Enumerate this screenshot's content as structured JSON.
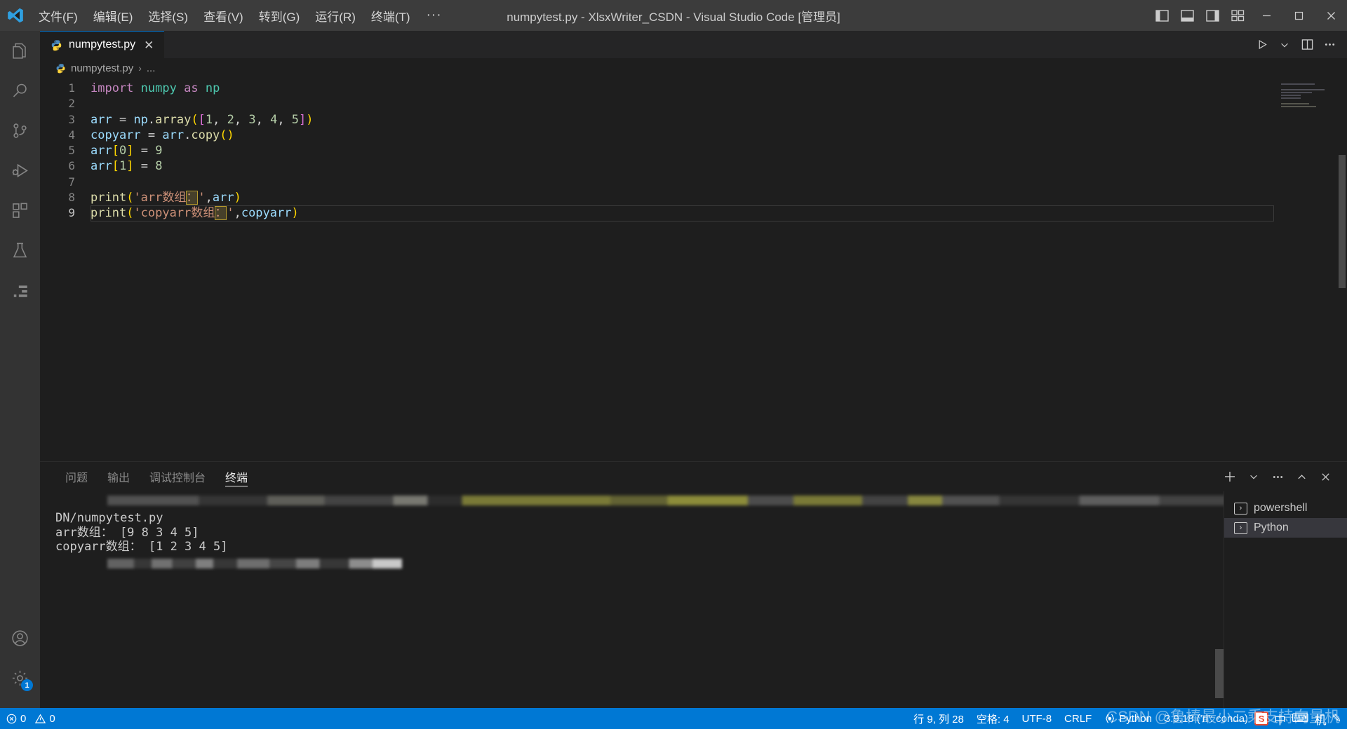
{
  "window": {
    "title": "numpytest.py - XlsxWriter_CSDN - Visual Studio Code [管理员]",
    "minimize_label": "─",
    "maximize_label": "☐",
    "close_label": "✕"
  },
  "menubar": {
    "items": [
      {
        "label": "文件(F)",
        "name": "menu-file"
      },
      {
        "label": "编辑(E)",
        "name": "menu-edit"
      },
      {
        "label": "选择(S)",
        "name": "menu-selection"
      },
      {
        "label": "查看(V)",
        "name": "menu-view"
      },
      {
        "label": "转到(G)",
        "name": "menu-go"
      },
      {
        "label": "运行(R)",
        "name": "menu-run"
      },
      {
        "label": "终端(T)",
        "name": "menu-terminal"
      }
    ],
    "overflow": "···"
  },
  "activitybar": {
    "items": [
      {
        "icon": "files-explorer-icon",
        "title": "资源管理器"
      },
      {
        "icon": "search-icon",
        "title": "搜索"
      },
      {
        "icon": "source-control-icon",
        "title": "源代码管理"
      },
      {
        "icon": "run-and-debug-icon",
        "title": "运行和调试"
      },
      {
        "icon": "extensions-icon",
        "title": "扩展"
      },
      {
        "icon": "testing-beaker-icon",
        "title": "测试"
      },
      {
        "icon": "remote-explorer-icon",
        "title": "远程资源管理器"
      }
    ],
    "bottom": [
      {
        "icon": "accounts-icon",
        "title": "帐户"
      },
      {
        "icon": "settings-gear-icon",
        "title": "管理",
        "badge": "1"
      }
    ]
  },
  "editor": {
    "tab": {
      "label": "numpytest.py",
      "icon": "python-file-icon",
      "close": "✕"
    },
    "actions": [
      {
        "icon": "run-play-icon",
        "name": "run-python-file-button"
      },
      {
        "icon": "chevron-down-icon",
        "name": "run-options-dropdown"
      },
      {
        "icon": "split-editor-icon",
        "name": "split-editor-button"
      },
      {
        "icon": "more-actions-icon",
        "name": "editor-more-actions-button"
      }
    ],
    "breadcrumb": {
      "file": "numpytest.py",
      "separator": "›",
      "trailing": "..."
    },
    "lines": [
      {
        "n": "1",
        "tokens": [
          {
            "t": "import",
            "c": "kw"
          },
          {
            "t": " ",
            "c": "op"
          },
          {
            "t": "numpy",
            "c": "mod"
          },
          {
            "t": " ",
            "c": "op"
          },
          {
            "t": "as",
            "c": "kw"
          },
          {
            "t": " ",
            "c": "op"
          },
          {
            "t": "np",
            "c": "mod"
          }
        ]
      },
      {
        "n": "2",
        "tokens": []
      },
      {
        "n": "3",
        "tokens": [
          {
            "t": "arr",
            "c": "var"
          },
          {
            "t": " = ",
            "c": "op"
          },
          {
            "t": "np",
            "c": "var"
          },
          {
            "t": ".",
            "c": "op"
          },
          {
            "t": "array",
            "c": "fn"
          },
          {
            "t": "(",
            "c": "pn1"
          },
          {
            "t": "[",
            "c": "pn2"
          },
          {
            "t": "1",
            "c": "num"
          },
          {
            "t": ", ",
            "c": "op"
          },
          {
            "t": "2",
            "c": "num"
          },
          {
            "t": ", ",
            "c": "op"
          },
          {
            "t": "3",
            "c": "num"
          },
          {
            "t": ", ",
            "c": "op"
          },
          {
            "t": "4",
            "c": "num"
          },
          {
            "t": ", ",
            "c": "op"
          },
          {
            "t": "5",
            "c": "num"
          },
          {
            "t": "]",
            "c": "pn2"
          },
          {
            "t": ")",
            "c": "pn1"
          }
        ]
      },
      {
        "n": "4",
        "tokens": [
          {
            "t": "copyarr",
            "c": "var"
          },
          {
            "t": " = ",
            "c": "op"
          },
          {
            "t": "arr",
            "c": "var"
          },
          {
            "t": ".",
            "c": "op"
          },
          {
            "t": "copy",
            "c": "fn"
          },
          {
            "t": "()",
            "c": "pn1"
          }
        ]
      },
      {
        "n": "5",
        "tokens": [
          {
            "t": "arr",
            "c": "var"
          },
          {
            "t": "[",
            "c": "pn1"
          },
          {
            "t": "0",
            "c": "num"
          },
          {
            "t": "]",
            "c": "pn1"
          },
          {
            "t": " = ",
            "c": "op"
          },
          {
            "t": "9",
            "c": "num"
          }
        ]
      },
      {
        "n": "6",
        "tokens": [
          {
            "t": "arr",
            "c": "var"
          },
          {
            "t": "[",
            "c": "pn1"
          },
          {
            "t": "1",
            "c": "num"
          },
          {
            "t": "]",
            "c": "pn1"
          },
          {
            "t": " = ",
            "c": "op"
          },
          {
            "t": "8",
            "c": "num"
          }
        ]
      },
      {
        "n": "7",
        "tokens": []
      },
      {
        "n": "8",
        "tokens": [
          {
            "t": "print",
            "c": "fn"
          },
          {
            "t": "(",
            "c": "pn1"
          },
          {
            "t": "'arr数组",
            "c": "str"
          },
          {
            "t": "：",
            "c": "str hl-box"
          },
          {
            "t": "'",
            "c": "str"
          },
          {
            "t": ",",
            "c": "op"
          },
          {
            "t": "arr",
            "c": "var"
          },
          {
            "t": ")",
            "c": "pn1"
          }
        ]
      },
      {
        "n": "9",
        "current": true,
        "tokens": [
          {
            "t": "print",
            "c": "fn"
          },
          {
            "t": "(",
            "c": "pn1"
          },
          {
            "t": "'copyarr数组",
            "c": "str"
          },
          {
            "t": "：",
            "c": "str hl-box"
          },
          {
            "t": "'",
            "c": "str"
          },
          {
            "t": ",",
            "c": "op"
          },
          {
            "t": "copyarr",
            "c": "var"
          },
          {
            "t": ")",
            "c": "pn1"
          }
        ]
      }
    ]
  },
  "panel": {
    "tabs": [
      {
        "label": "问题",
        "active": false,
        "name": "panel-tab-problems"
      },
      {
        "label": "输出",
        "active": false,
        "name": "panel-tab-output"
      },
      {
        "label": "调试控制台",
        "active": false,
        "name": "panel-tab-debug-console"
      },
      {
        "label": "终端",
        "active": true,
        "name": "panel-tab-terminal"
      }
    ],
    "actions": [
      {
        "icon": "new-terminal-plus-icon",
        "name": "new-terminal-button"
      },
      {
        "icon": "chevron-down-icon",
        "name": "terminal-profile-dropdown"
      },
      {
        "icon": "more-actions-icon",
        "name": "panel-more-actions-button"
      },
      {
        "icon": "chevron-up-icon",
        "name": "maximize-panel-button"
      },
      {
        "icon": "close-icon",
        "name": "close-panel-button"
      }
    ],
    "terminal": {
      "lines": [
        "DN/numpytest.py",
        "arr数组： [9 8 3 4 5]",
        "copyarr数组： [1 2 3 4 5]"
      ]
    },
    "terminal_list": [
      {
        "label": "powershell",
        "selected": false,
        "icon": "terminal-chevron-icon"
      },
      {
        "label": "Python",
        "selected": true,
        "icon": "terminal-chevron-icon"
      }
    ]
  },
  "statusbar": {
    "left": [
      {
        "icon": "error-icon",
        "value": "0",
        "name": "errors-count"
      },
      {
        "icon": "warning-icon",
        "value": "0",
        "name": "warnings-count"
      }
    ],
    "right": [
      {
        "label": "行 9, 列 28",
        "name": "cursor-position"
      },
      {
        "label": "空格: 4",
        "name": "indentation"
      },
      {
        "label": "UTF-8",
        "name": "encoding"
      },
      {
        "label": "CRLF",
        "name": "eol"
      },
      {
        "label": "Python",
        "icon": "brackets-icon",
        "name": "language-mode"
      },
      {
        "label": "3.9.18 ('rl': conda)",
        "name": "python-interpreter"
      }
    ],
    "watermark": "CSDN @鲁棒最小二乘支持向量机",
    "tray": {
      "ime": "S",
      "lang": "中",
      "keyboard": "⌨",
      "extra": "机",
      "pen": "✎"
    }
  },
  "colors": {
    "accent": "#0078d4",
    "titlebar_bg": "#3c3c3c",
    "activitybar_bg": "#333333",
    "editor_bg": "#1e1e1e",
    "tabs_bg": "#252526",
    "highlight_box": "#46402a",
    "highlight_border": "#b59a2e"
  }
}
